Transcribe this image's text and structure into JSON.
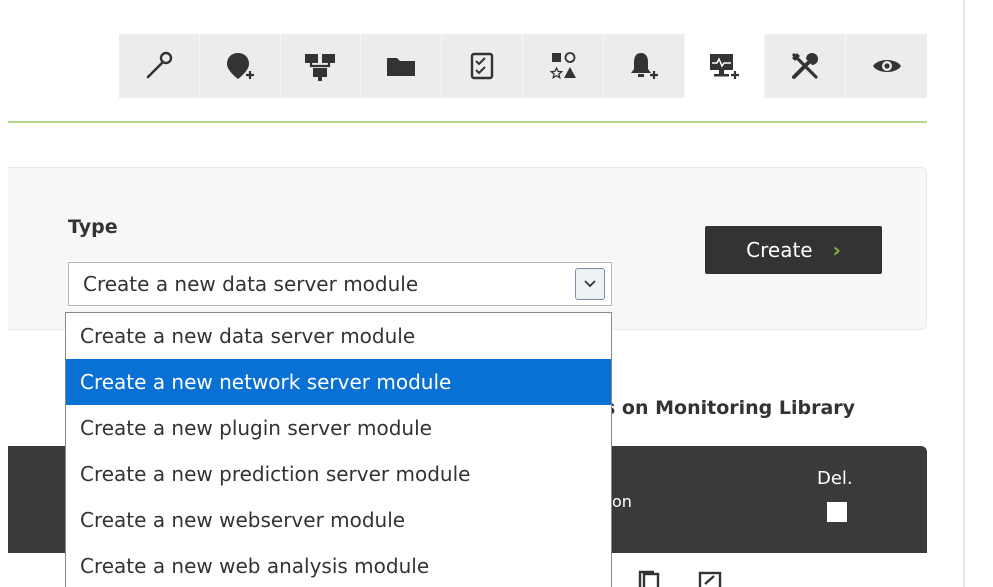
{
  "toolbar": {
    "items": [
      {
        "icon": "wand-icon"
      },
      {
        "icon": "add-location-icon"
      },
      {
        "icon": "network-icon"
      },
      {
        "icon": "folder-icon"
      },
      {
        "icon": "checklist-icon"
      },
      {
        "icon": "shapes-icon"
      },
      {
        "icon": "add-alert-icon"
      },
      {
        "icon": "add-monitor-icon",
        "active": true
      },
      {
        "icon": "tools-icon"
      },
      {
        "icon": "eye-icon"
      }
    ]
  },
  "form": {
    "type_label": "Type",
    "selected_value": "Create a new data server module",
    "create_label": "Create",
    "create_arrow": "›"
  },
  "dropdown": {
    "options": [
      "Create a new data server module",
      "Create a new network server module",
      "Create a new plugin server module",
      "Create a new prediction server module",
      "Create a new webserver module",
      "Create a new web analysis module"
    ],
    "highlighted_index": 1
  },
  "table": {
    "heading_fragment": "s on Monitoring Library",
    "col_fragment": "on",
    "del_label": "Del."
  },
  "colors": {
    "accent_green": "#80b83c",
    "highlight_blue": "#0a71d4",
    "dark_header": "#3a3a3a"
  }
}
